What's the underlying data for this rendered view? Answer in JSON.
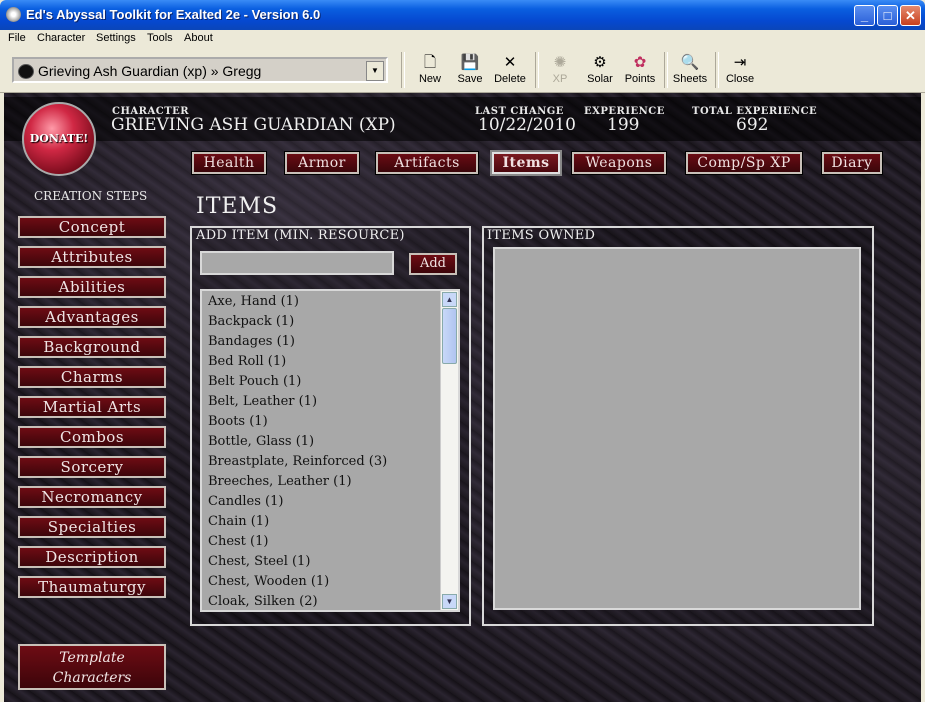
{
  "window": {
    "title": "Ed's Abyssal Toolkit for Exalted 2e - Version 6.0"
  },
  "menu": [
    "File",
    "Character",
    "Settings",
    "Tools",
    "About"
  ],
  "toolbar": {
    "character_select": "Grieving Ash Guardian (xp) » Gregg",
    "buttons": {
      "new": "New",
      "save": "Save",
      "delete": "Delete",
      "xp": "XP",
      "solar": "Solar",
      "points": "Points",
      "sheets": "Sheets",
      "close": "Close"
    }
  },
  "header": {
    "donate": "DONATE!",
    "character_label": "CHARACTER",
    "character_name": "GRIEVING ASH GUARDIAN (XP)",
    "last_change_label": "LAST CHANGE",
    "last_change": "10/22/2010",
    "experience_label": "EXPERIENCE",
    "experience": "199",
    "total_experience_label": "TOTAL EXPERIENCE",
    "total_experience": "692"
  },
  "tabs": [
    "Health",
    "Armor",
    "Artifacts",
    "Items",
    "Weapons",
    "Comp/Sp XP",
    "Diary"
  ],
  "active_tab": "Items",
  "creation_steps": {
    "title": "CREATION STEPS",
    "items": [
      "Concept",
      "Attributes",
      "Abilities",
      "Advantages",
      "Background",
      "Charms",
      "Martial Arts",
      "Combos",
      "Sorcery",
      "Necromancy",
      "Specialties",
      "Description",
      "Thaumaturgy"
    ],
    "template_line1": "Template",
    "template_line2": "Characters"
  },
  "items_page": {
    "title": "ITEMS",
    "add_label": "ADD ITEM (MIN. RESOURCE)",
    "add_button": "Add",
    "add_value": "",
    "owned_label": "ITEMS OWNED",
    "catalog": [
      "Axe, Hand (1)",
      "Backpack (1)",
      "Bandages (1)",
      "Bed Roll (1)",
      "Belt Pouch (1)",
      "Belt, Leather (1)",
      "Boots (1)",
      "Bottle, Glass (1)",
      "Breastplate, Reinforced (3)",
      "Breeches, Leather (1)",
      "Candles (1)",
      "Chain (1)",
      "Chest (1)",
      "Chest, Steel (1)",
      "Chest, Wooden (1)",
      "Cloak, Silken (2)"
    ]
  }
}
